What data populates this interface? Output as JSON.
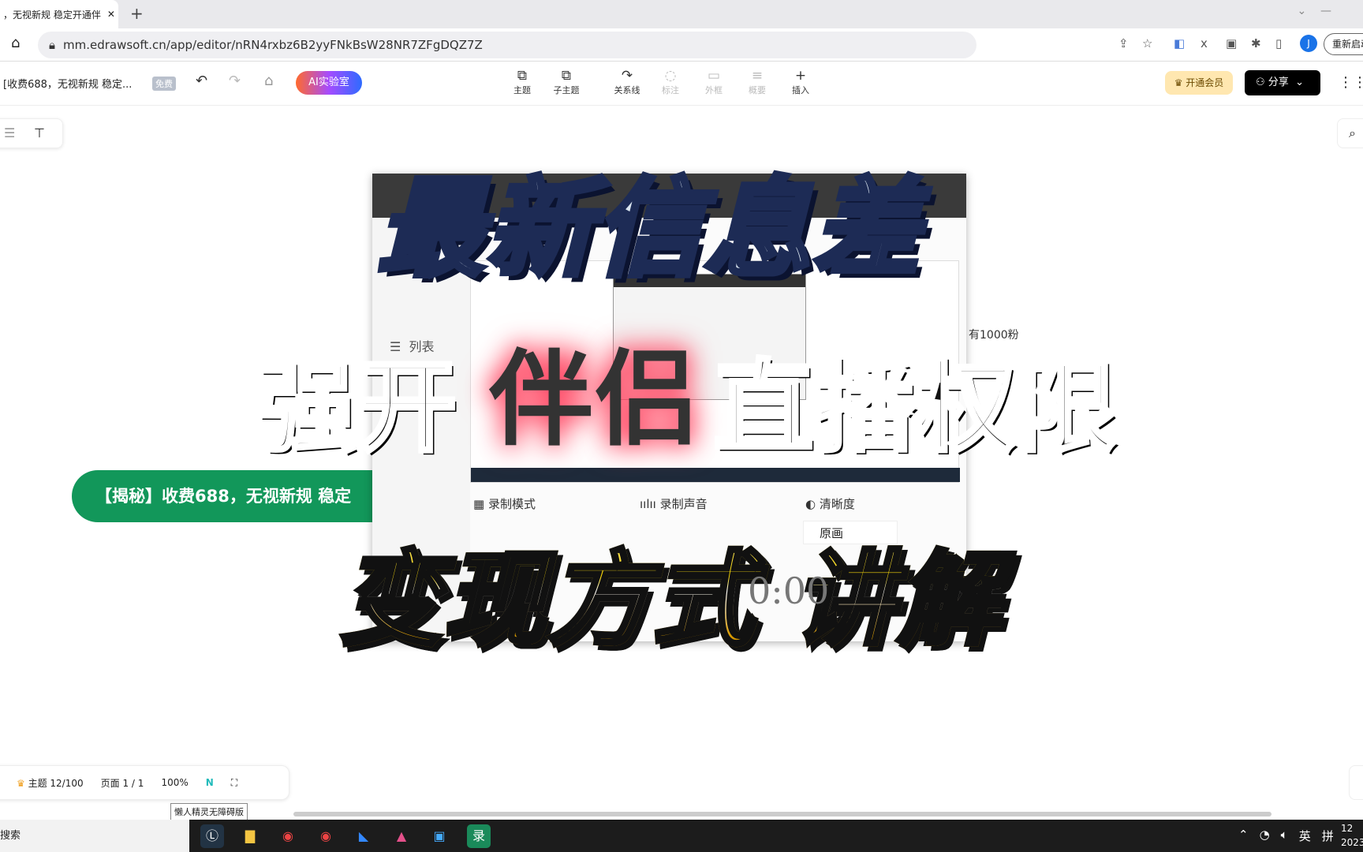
{
  "browser": {
    "tab_title": "，无视新规 稳定开通伴",
    "url": "mm.edrawsoft.cn/app/editor/nRN4rxbz6B2yyFNkBsW28NR7ZFgDQZ7Z",
    "restart_label": "重新启动",
    "avatar_letter": "J"
  },
  "toolbar": {
    "doc_title": "[收费688，无视新规 稳定...",
    "free_badge": "免费",
    "ai_label": "AI实验室",
    "tools": [
      {
        "label": "主题",
        "glyph": "⧉",
        "enabled": true
      },
      {
        "label": "子主题",
        "glyph": "⧉",
        "enabled": true
      },
      {
        "label": "关系线",
        "glyph": "↷",
        "enabled": true
      },
      {
        "label": "标注",
        "glyph": "◌",
        "enabled": false
      },
      {
        "label": "外框",
        "glyph": "▭",
        "enabled": false
      },
      {
        "label": "概要",
        "glyph": "≡",
        "enabled": false
      },
      {
        "label": "插入",
        "glyph": "+",
        "enabled": true
      }
    ],
    "vip_label": "开通会员",
    "share_label": "分享"
  },
  "canvas": {
    "node_text": "【揭秘】收费688，无视新规 稳定",
    "side_node_text": "有1000粉"
  },
  "recorder": {
    "list_label": "列表",
    "options": [
      "录制模式",
      "录制声音",
      "清晰度"
    ],
    "quality_value": "原画",
    "timer": "0:00"
  },
  "overlay": {
    "line1": "最新信息差",
    "line2a": "强开",
    "line2b": "伴侣",
    "line2c": "直播权限",
    "line3": "变现方式 讲解"
  },
  "statusbar": {
    "topics": "主题 12/100",
    "page_label": "页面",
    "page_value": "1 / 1",
    "zoom": "100%",
    "tooltip": "懒人精灵无障碍版"
  },
  "taskbar": {
    "search": "搜索",
    "tray_lang": "英",
    "tray_ime": "拼",
    "clock_time": "12",
    "clock_date": "2023"
  },
  "colors": {
    "node_green": "#12975a",
    "share_black": "#000000",
    "vip_bg": "#ffe7b0"
  }
}
